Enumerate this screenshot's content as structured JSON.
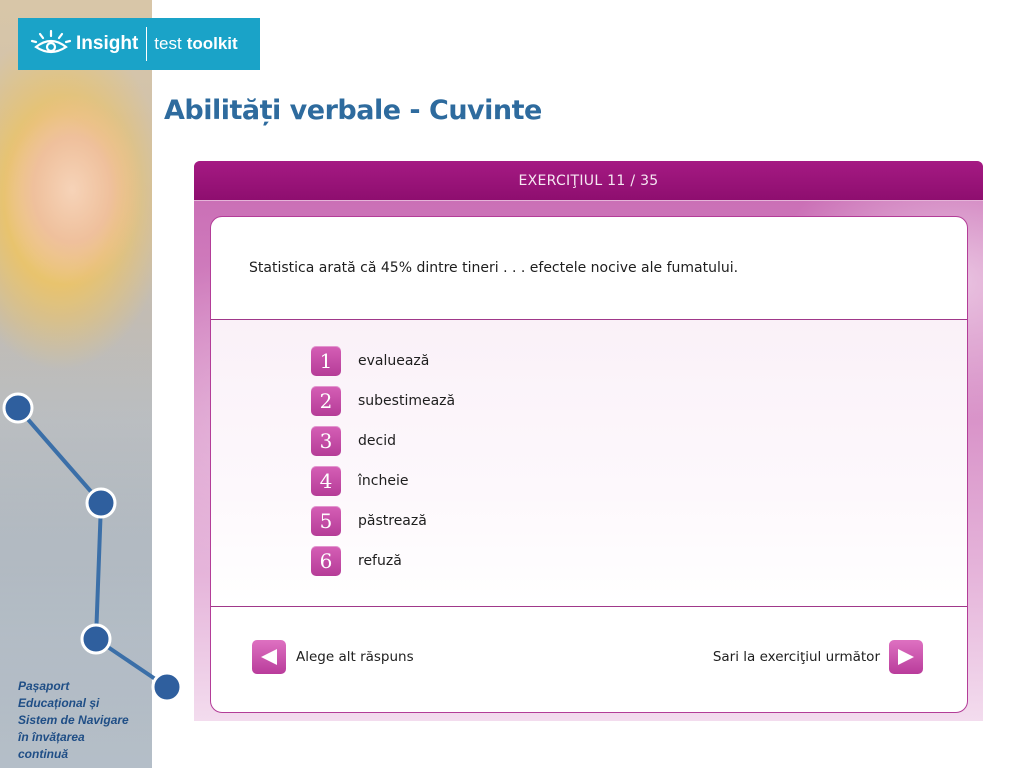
{
  "branding": {
    "logo_word": "Insight",
    "logo_test": "test",
    "logo_toolkit": "toolkit"
  },
  "page": {
    "title": "Abilități verbale - Cuvinte"
  },
  "exercise": {
    "header_label": "EXERCIŢIUL 11 / 35",
    "question": "Statistica arată că 45% dintre tineri . . . efectele nocive ale fumatului.",
    "options": [
      {
        "number": "1",
        "label": "evaluează"
      },
      {
        "number": "2",
        "label": "subestimează"
      },
      {
        "number": "3",
        "label": "decid"
      },
      {
        "number": "4",
        "label": "încheie"
      },
      {
        "number": "5",
        "label": "păstrează"
      },
      {
        "number": "6",
        "label": "refuză"
      }
    ]
  },
  "navigation": {
    "prev_label": "Alege alt răspuns",
    "next_label": "Sari la exerciţiul următor"
  },
  "sidebar": {
    "caption": "Pașaport\nEducațional și\nSistem de Navigare\nîn învățarea\ncontinuă"
  },
  "colors": {
    "accent": "#b53c97",
    "header": "#9a1479",
    "title": "#2e6b9e",
    "logo_bg": "#1aa3c8"
  }
}
